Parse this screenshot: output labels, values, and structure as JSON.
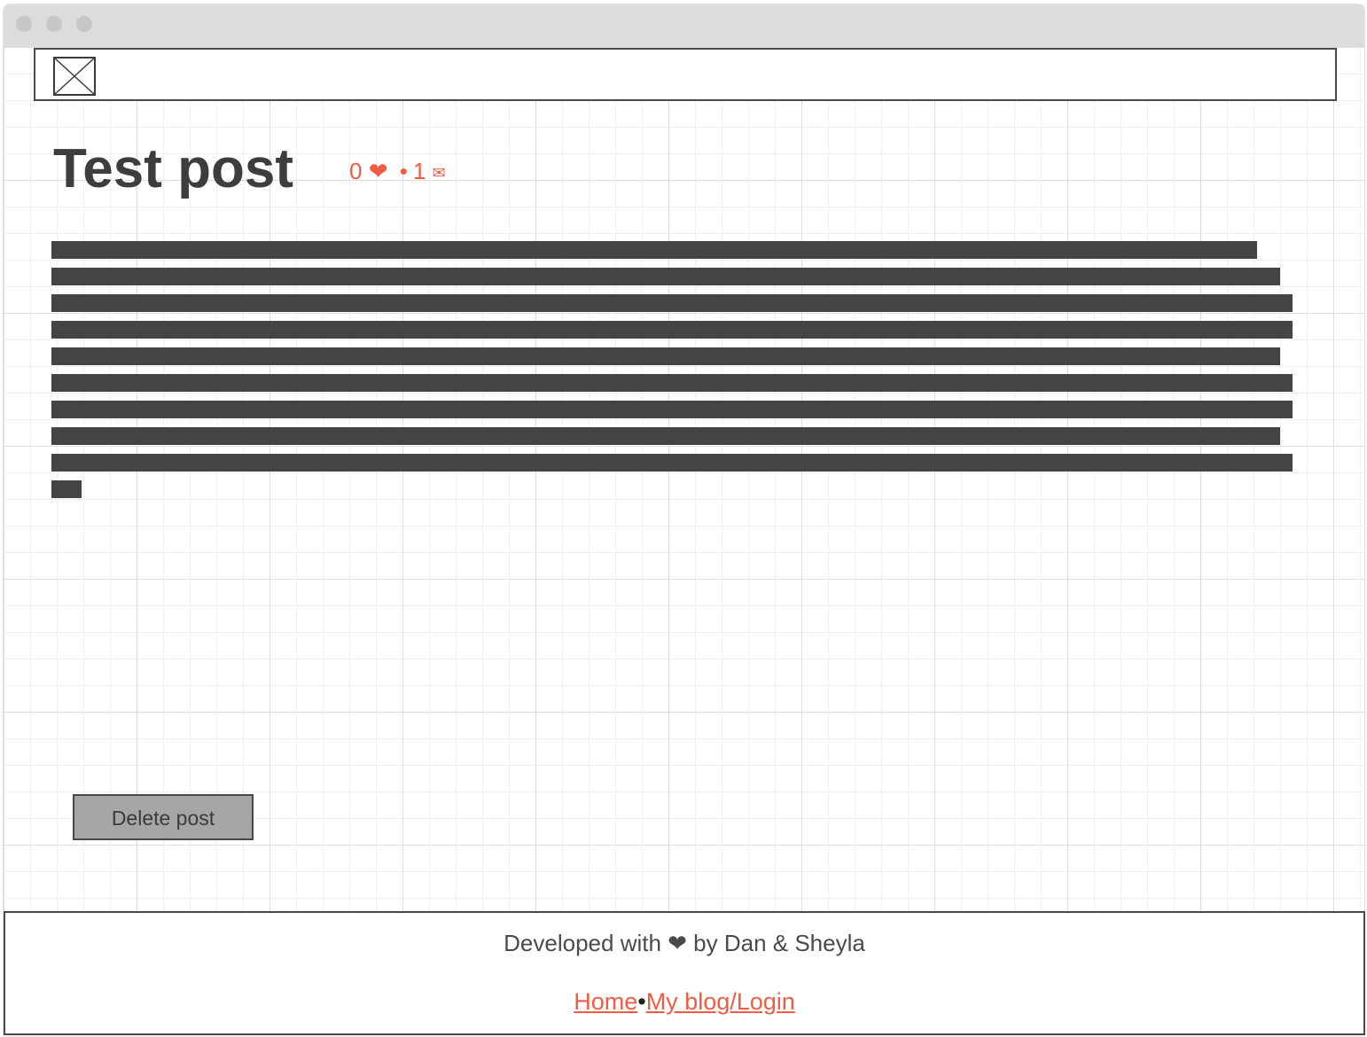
{
  "window": {
    "traffic_lights": [
      "close",
      "minimize",
      "maximize"
    ]
  },
  "header": {
    "logo_icon": "image-placeholder-icon"
  },
  "post": {
    "title": "Test post",
    "likes_count": "0",
    "likes_icon": "heart-icon",
    "separator": "•",
    "comments_count": "1",
    "comments_icon": "envelope-icon",
    "body_placeholder_lines": 10
  },
  "actions": {
    "delete_label": "Delete post"
  },
  "footer": {
    "credit": "Developed with ❤ by Dan & Sheyla",
    "links": [
      {
        "label": "Home"
      },
      {
        "label": "My blog/Login"
      }
    ],
    "link_separator": "•"
  },
  "colors": {
    "accent": "#f25c45",
    "text_dark": "#3d3d3d",
    "placeholder_text": "#444444",
    "button_bg": "#a6a6a6"
  }
}
